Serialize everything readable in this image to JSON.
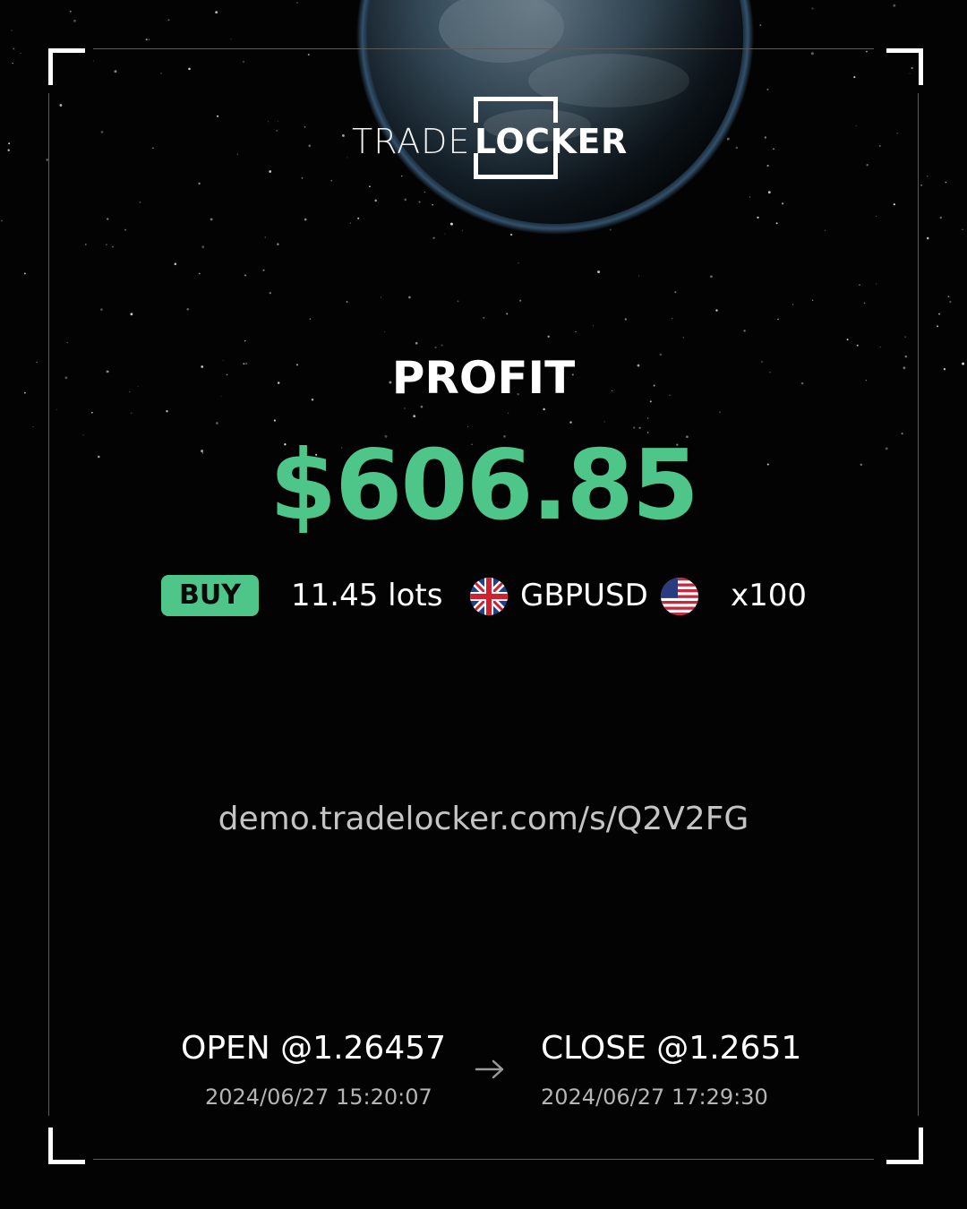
{
  "brand": {
    "logo_light": "TRADE",
    "logo_bold": "LOCKER",
    "icon": "tradelocker-logo"
  },
  "result": {
    "label": "PROFIT",
    "amount": "$606.85",
    "amount_color": "#4ec68a"
  },
  "trade": {
    "side": "BUY",
    "side_color": "#4ec68a",
    "lots": "11.45 lots",
    "base_flag_icon": "uk-flag-icon",
    "symbol": "GBPUSD",
    "quote_flag_icon": "us-flag-icon",
    "leverage": "x100"
  },
  "share_link": "demo.tradelocker.com/s/Q2V2FG",
  "open": {
    "price": "OPEN @1.26457",
    "time": "2024/06/27 15:20:07"
  },
  "close": {
    "price": "CLOSE @1.2651",
    "time": "2024/06/27 17:29:30"
  },
  "arrow_icon": "arrow-right-icon",
  "colors": {
    "background": "#030303",
    "frame": "#ffffff",
    "text_secondary": "#c4c4c4"
  }
}
